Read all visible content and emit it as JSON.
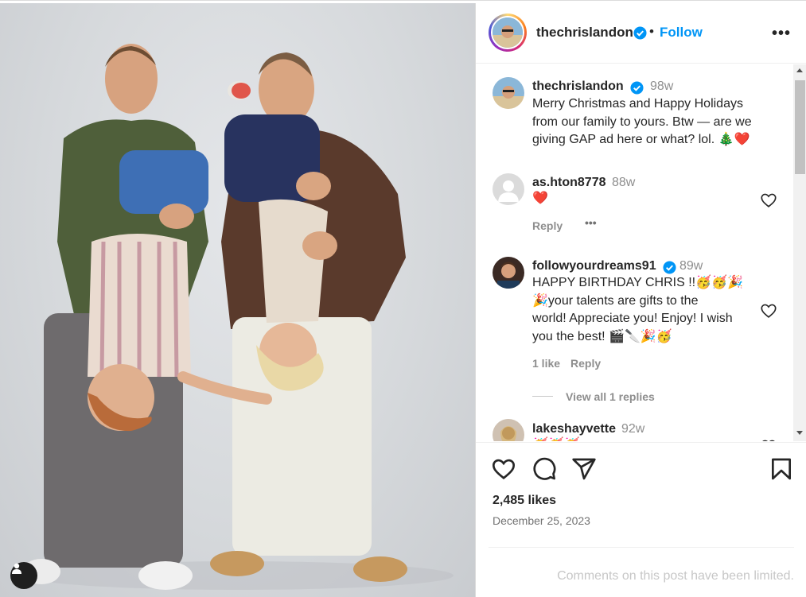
{
  "post": {
    "author": "thechrislandon",
    "follow_label": "Follow",
    "dot": "•",
    "more_label": "•••",
    "photo_description_icon": "user-tag-icon"
  },
  "comments": [
    {
      "username": "thechrislandon",
      "time": "98w",
      "verified": true,
      "text_lines": [
        "Merry Christmas and Happy Holidays",
        "from our family to yours. Btw — are we",
        "giving GAP ad here or what? lol. 🎄❤️"
      ]
    },
    {
      "username": "as.hton8778",
      "time": "88w",
      "verified": false,
      "text_lines": [
        "❤️"
      ],
      "reply_label": "Reply",
      "more_label": "•••"
    },
    {
      "username": "followyourdreams91",
      "time": "89w",
      "verified": true,
      "text_lines": [
        "HAPPY BIRTHDAY CHRIS !!🥳🥳🎉",
        "🎉your talents are gifts to the",
        "world! Appreciate you! Enjoy! I wish",
        "you the best! 🎬🔪🎉🥳"
      ],
      "likes_label": "1 like",
      "reply_label": "Reply",
      "view_replies_label": "View all 1 replies"
    },
    {
      "username": "lakeshayvette",
      "time": "92w",
      "verified": false,
      "text_lines": [
        "🥳🥳🥳"
      ]
    }
  ],
  "actions": {
    "icons": [
      "heart-icon",
      "comment-icon",
      "share-icon",
      "bookmark-icon"
    ],
    "likes": "2,485 likes",
    "date": "December 25, 2023"
  },
  "footer": {
    "limited_text": "Comments on this post have been limited."
  },
  "colors": {
    "follow": "#0095f6",
    "verified": "#0095f6",
    "heart_red": "#e0245e",
    "muted": "#8e8e8e"
  }
}
